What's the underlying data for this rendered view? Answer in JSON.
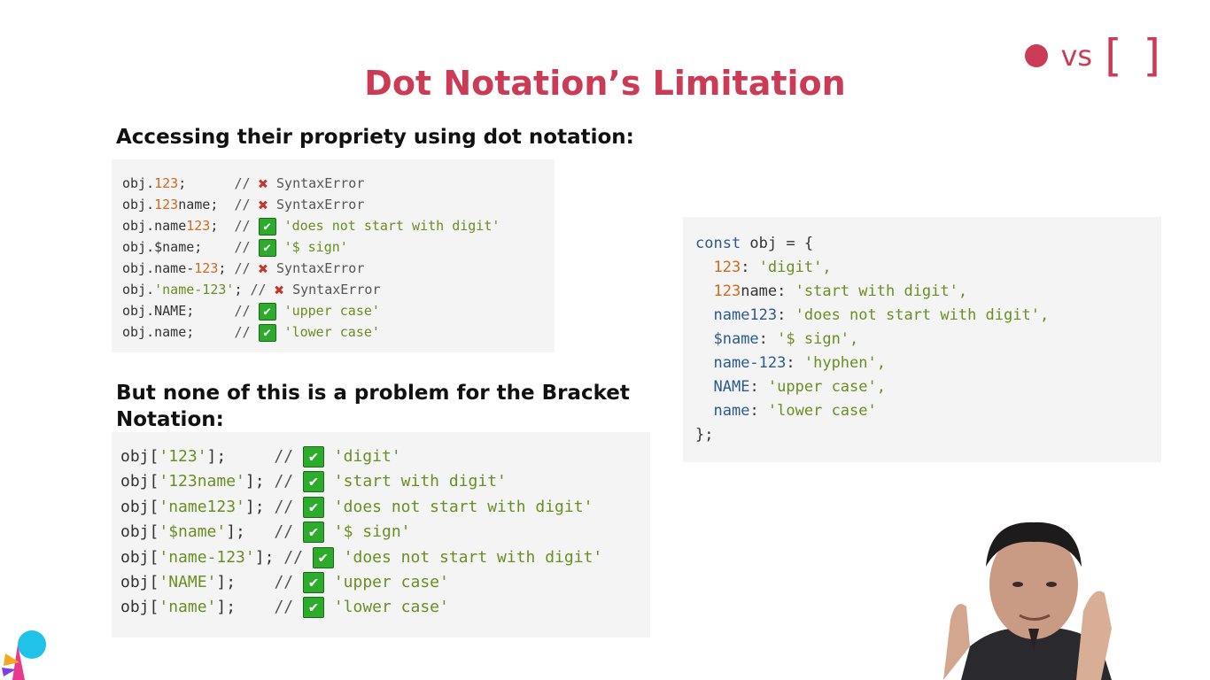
{
  "title": "Dot Notation’s Limitation",
  "badge": {
    "vs": "vs",
    "brackets": "[ ]"
  },
  "heading1": "Accessing their propriety using dot notation:",
  "heading2": "But none of this is a problem for the Bracket Notation:",
  "dot_lines": [
    {
      "code": "obj.123;",
      "comment": "//",
      "status": "error",
      "message": "SyntaxError"
    },
    {
      "code": "obj.123name;",
      "comment": "//",
      "status": "error",
      "message": "SyntaxError"
    },
    {
      "code": "obj.name123;",
      "comment": "//",
      "status": "ok",
      "message": "'does not start with digit'"
    },
    {
      "code": "obj.$name;",
      "comment": "//",
      "status": "ok",
      "message": "'$ sign'"
    },
    {
      "code": "obj.name-123;",
      "comment": "//",
      "status": "error",
      "message": "SyntaxError"
    },
    {
      "code": "obj.'name-123';",
      "comment": "//",
      "status": "error",
      "message": "SyntaxError"
    },
    {
      "code": "obj.NAME;",
      "comment": "//",
      "status": "ok",
      "message": "'upper case'"
    },
    {
      "code": "obj.name;",
      "comment": "//",
      "status": "ok",
      "message": "'lower case'"
    }
  ],
  "bracket_lines": [
    {
      "code": "obj['123'];",
      "comment": "//",
      "status": "ok",
      "message": "'digit'"
    },
    {
      "code": "obj['123name'];",
      "comment": "//",
      "status": "ok",
      "message": "'start with digit'"
    },
    {
      "code": "obj['name123'];",
      "comment": "//",
      "status": "ok",
      "message": "'does not start with digit'"
    },
    {
      "code": "obj['$name'];",
      "comment": "//",
      "status": "ok",
      "message": "'$ sign'"
    },
    {
      "code": "obj['name-123'];",
      "comment": "//",
      "status": "ok",
      "message": "'does not start with digit'"
    },
    {
      "code": "obj['NAME'];",
      "comment": "//",
      "status": "ok",
      "message": "'upper case'"
    },
    {
      "code": "obj['name'];",
      "comment": "//",
      "status": "ok",
      "message": "'lower case'"
    }
  ],
  "obj_decl": {
    "open": "const obj = {",
    "props": [
      {
        "key": "123",
        "value": "'digit',"
      },
      {
        "key": "123name",
        "value": "'start with digit',"
      },
      {
        "key": "name123",
        "value": "'does not start with digit',"
      },
      {
        "key": "$name",
        "value": "'$ sign',"
      },
      {
        "key": "name-123",
        "value": "'hyphen',"
      },
      {
        "key": "NAME",
        "value": "'upper case',"
      },
      {
        "key": "name",
        "value": "'lower case'"
      }
    ],
    "close": "};"
  },
  "icons": {
    "error": "cross-mark-icon",
    "ok": "check-mark-icon",
    "logo": "app-logo-icon"
  },
  "colors": {
    "accent": "#cc3b55",
    "ok": "#2dab2d",
    "error": "#c0392b",
    "code_bg": "#f4f4f4"
  }
}
